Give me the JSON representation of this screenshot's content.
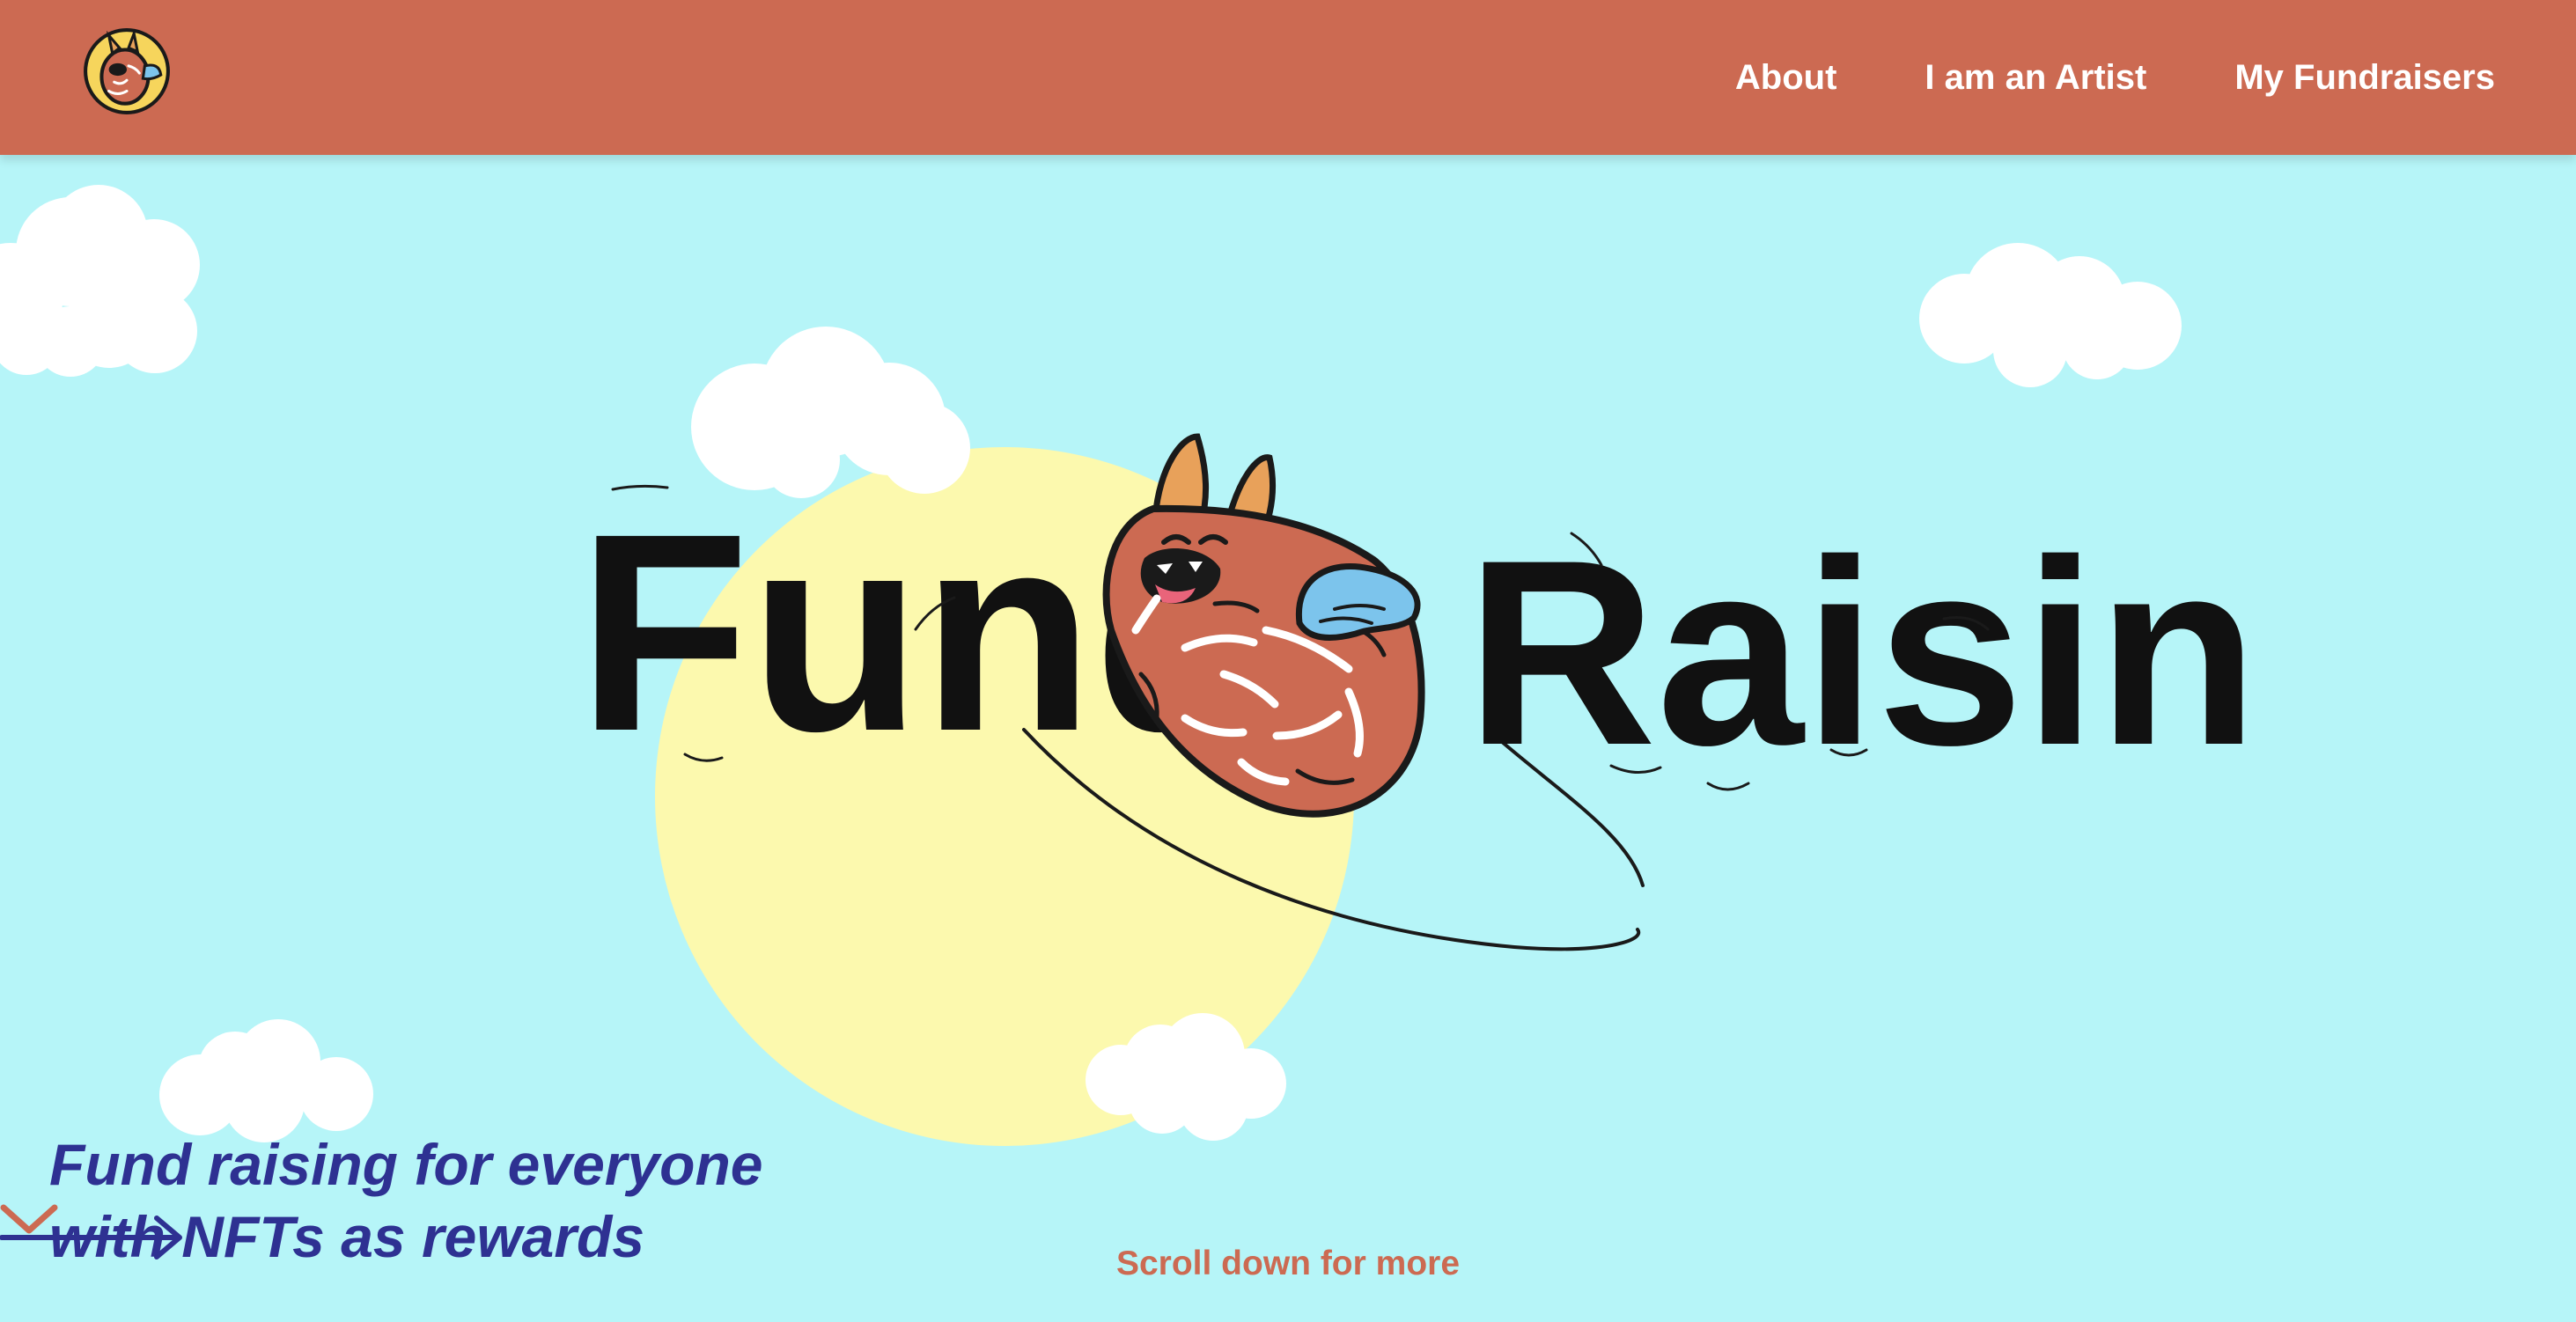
{
  "colors": {
    "navbar": "#cc6a52",
    "sky": "#b6f5f8",
    "sun": "#fcf9ae",
    "tagline": "#2e3192",
    "scroll_hint": "#cc6a52",
    "mascot": "#cc6a52",
    "mascot_wing": "#7cc4ec"
  },
  "nav": {
    "logo_icon": "raisin-mascot-logo-icon",
    "links": [
      "About",
      "I am an Artist",
      "My Fundraisers"
    ]
  },
  "hero": {
    "wordmark": [
      "Fund",
      "Raisin"
    ],
    "tagline": [
      "Fund raising for everyone",
      "with NFTs as rewards"
    ],
    "scroll_hint": "Scroll down for more"
  }
}
